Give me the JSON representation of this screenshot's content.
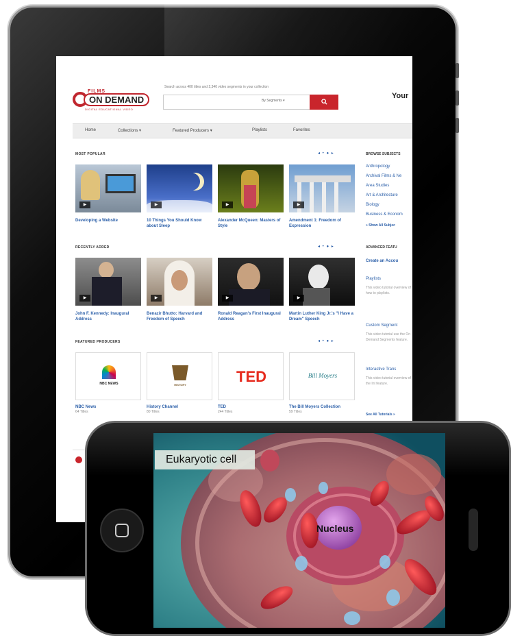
{
  "site": {
    "logo_top": "FILMS",
    "logo_main": "ON DEMAND",
    "logo_sub": "DIGITAL EDUCATIONAL VIDEO",
    "search_note": "Search across 400 titles and 2,340 video segments in your collection",
    "search_select": "By Segments",
    "search_icon": "search-icon",
    "your_label": "Your",
    "nav": [
      "Home",
      "Collections ▾",
      "Featured Producers ▾",
      "Playlists",
      "Favorites"
    ],
    "most_popular": {
      "heading": "MOST POPULAR",
      "items": [
        {
          "title": "Developing a Website"
        },
        {
          "title": "10 Things You Should Know about Sleep"
        },
        {
          "title": "Alexander McQueen: Masters of Style"
        },
        {
          "title": "Amendment 1: Freedom of Expression"
        }
      ]
    },
    "recently_added": {
      "heading": "RECENTLY ADDED",
      "items": [
        {
          "title": "John F. Kennedy: Inaugural Address"
        },
        {
          "title": "Benazir Bhutto: Harvard and Freedom of Speech"
        },
        {
          "title": "Ronald Reagan's First Inaugural Address"
        },
        {
          "title": "Martin Luther King Jr.'s \"I Have a Dream\" Speech"
        }
      ]
    },
    "featured_producers": {
      "heading": "FEATURED PRODUCERS",
      "items": [
        {
          "logo": "NBC NEWS",
          "name": "NBC News",
          "count": "64 Titles"
        },
        {
          "logo": "HISTORY",
          "name": "History Channel",
          "count": "80 Titles"
        },
        {
          "logo": "TED",
          "name": "TED",
          "count": "244 Titles"
        },
        {
          "logo": "Bill Moyers",
          "name": "The Bill Moyers Collection",
          "count": "59 Titles"
        }
      ]
    },
    "sidebar": {
      "browse_heading": "BROWSE SUBJECTS",
      "subjects": [
        "Anthropology",
        "Archival Films & Ne",
        "Area Studies",
        "Art & Architecture",
        "Biology",
        "Business & Econom"
      ],
      "show_all": "» Show All Subjec",
      "advanced_heading": "ADVANCED FEATU",
      "create_account": "Create an Accou",
      "features": [
        {
          "title": "Playlists",
          "desc": "This video tutorial overview of how to playlists."
        },
        {
          "title": "Custom Segment",
          "desc": "This video tutorial use the On Demand Segments feature."
        },
        {
          "title": "Interactive Trans",
          "desc": "This video tutorial overview of the Int feature."
        }
      ],
      "see_all": "See All Tutorials »"
    }
  },
  "video": {
    "label": "Eukaryotic cell",
    "nucleus_label": "Nucleus"
  },
  "colors": {
    "brand_red": "#c9252c",
    "link_blue": "#2a5ea8"
  }
}
